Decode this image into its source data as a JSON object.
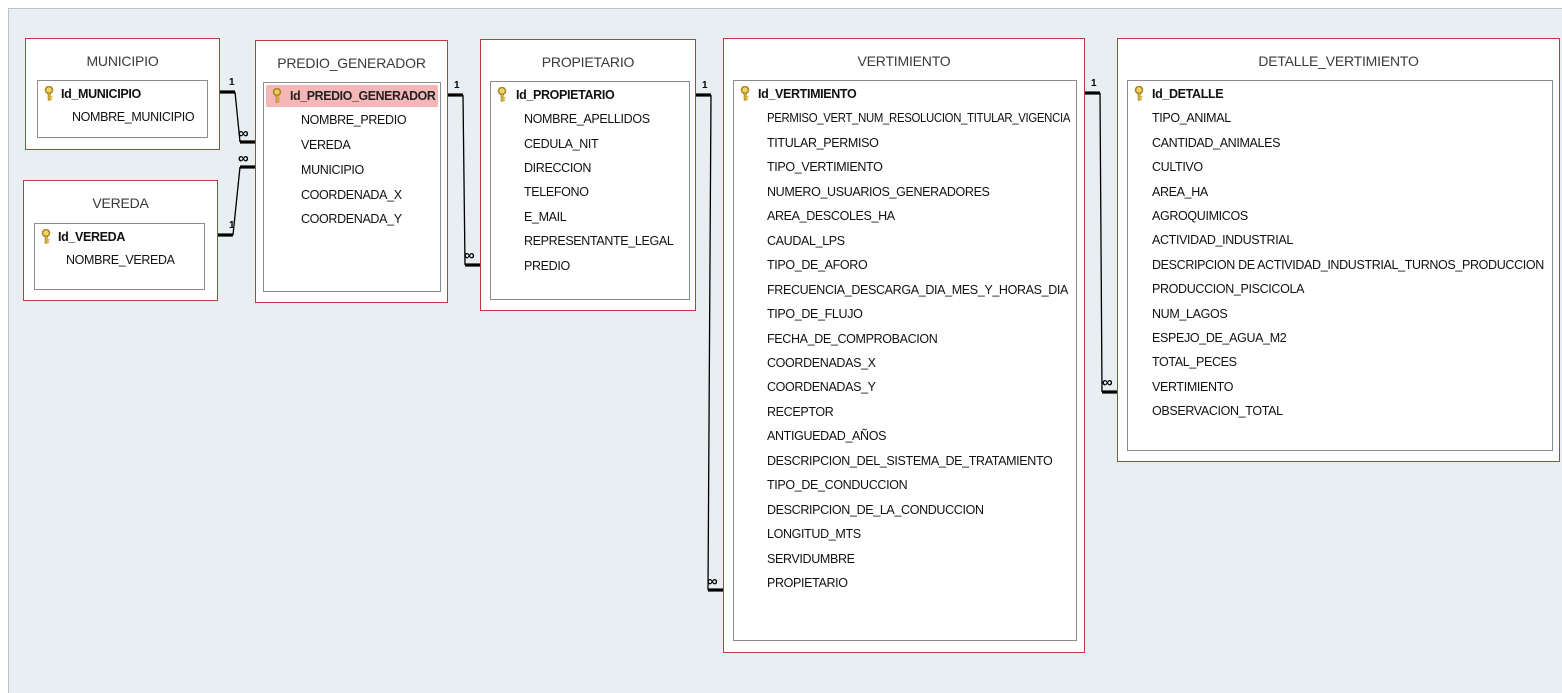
{
  "tables": {
    "municipio": {
      "title": "MUNICIPIO",
      "fields": [
        "Id_MUNICIPIO",
        "NOMBRE_MUNICIPIO"
      ]
    },
    "vereda": {
      "title": "VEREDA",
      "fields": [
        "Id_VEREDA",
        "NOMBRE_VEREDA"
      ]
    },
    "predio_generador": {
      "title": "PREDIO_GENERADOR",
      "fields": [
        "Id_PREDIO_GENERADOR",
        "NOMBRE_PREDIO",
        "VEREDA",
        "MUNICIPIO",
        "COORDENADA_X",
        "COORDENADA_Y"
      ]
    },
    "propietario": {
      "title": "PROPIETARIO",
      "fields": [
        "Id_PROPIETARIO",
        "NOMBRE_APELLIDOS",
        "CEDULA_NIT",
        "DIRECCION",
        "TELEFONO",
        "E_MAIL",
        "REPRESENTANTE_LEGAL",
        "PREDIO"
      ]
    },
    "vertimiento": {
      "title": "VERTIMIENTO",
      "fields": [
        "Id_VERTIMIENTO",
        "PERMISO_VERT_NUM_RESOLUCION_TITULAR_VIGENCIA",
        "TITULAR_PERMISO",
        "TIPO_VERTIMIENTO",
        "NUMERO_USUARIOS_GENERADORES",
        "AREA_DESCOLES_HA",
        "CAUDAL_LPS",
        "TIPO_DE_AFORO",
        "FRECUENCIA_DESCARGA_DIA_MES_Y_HORAS_DIA",
        "TIPO_DE_FLUJO",
        "FECHA_DE_COMPROBACION",
        "COORDENADAS_X",
        "COORDENADAS_Y",
        "RECEPTOR",
        "ANTIGUEDAD_AÑOS",
        "DESCRIPCION_DEL_SISTEMA_DE_TRATAMIENTO",
        "TIPO_DE_CONDUCCION",
        "DESCRIPCION_DE_LA_CONDUCCION",
        "LONGITUD_MTS",
        "SERVIDUMBRE",
        "PROPIETARIO"
      ]
    },
    "detalle_vertimiento": {
      "title": "DETALLE_VERTIMIENTO",
      "fields": [
        "Id_DETALLE",
        "TIPO_ANIMAL",
        "CANTIDAD_ANIMALES",
        "CULTIVO",
        "AREA_HA",
        "AGROQUIMICOS",
        "ACTIVIDAD_INDUSTRIAL",
        "DESCRIPCION DE ACTIVIDAD_INDUSTRIAL_TURNOS_PRODUCCION",
        "PRODUCCION_PISCICOLA",
        "NUM_LAGOS",
        "ESPEJO_DE_AGUA_M2",
        "TOTAL_PECES",
        "VERTIMIENTO",
        "OBSERVACION_TOTAL"
      ]
    }
  },
  "relationships": [
    {
      "one": "municipio",
      "many": "predio_generador",
      "one_label": "1",
      "many_label": "∞"
    },
    {
      "one": "vereda",
      "many": "predio_generador",
      "one_label": "1",
      "many_label": "∞"
    },
    {
      "one": "predio_generador",
      "many": "propietario",
      "one_label": "1",
      "many_label": "∞"
    },
    {
      "one": "propietario",
      "many": "vertimiento",
      "one_label": "1",
      "many_label": "∞"
    },
    {
      "one": "vertimiento",
      "many": "detalle_vertimiento",
      "one_label": "1",
      "many_label": "∞"
    }
  ],
  "colors": {
    "table_border": "#c0393b",
    "canvas_bg": "#e9eef3",
    "selected_row": "#f4b6b6",
    "key_icon": "#d9b23a"
  },
  "icons": {
    "primary_key": "key-icon"
  }
}
